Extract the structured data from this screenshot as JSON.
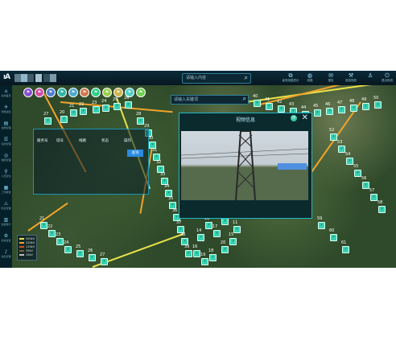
{
  "top_search": {
    "placeholder": "请输入内容"
  },
  "map_search": {
    "placeholder": "请输入关键词"
  },
  "tools": [
    {
      "label": "高亮线路显示",
      "icon": "layers-icon"
    },
    {
      "label": "线路",
      "icon": "globe-icon"
    },
    {
      "label": "报告",
      "icon": "mail-icon"
    },
    {
      "label": "巡检规划",
      "icon": "wrench-icon"
    },
    {
      "label": "",
      "icon": "user-icon"
    },
    {
      "label": "退出系统",
      "icon": "power-icon"
    }
  ],
  "sidebar": [
    {
      "label": "系统首页"
    },
    {
      "label": "智能巡检"
    },
    {
      "label": "台账管理"
    },
    {
      "label": "任务管理"
    },
    {
      "label": "缺陷管理"
    },
    {
      "label": "人员定位"
    },
    {
      "label": "工作报告"
    },
    {
      "label": "隐患管理"
    },
    {
      "label": "巡检统计"
    },
    {
      "label": "系统设置"
    },
    {
      "label": "消息管理"
    }
  ],
  "video_panel": {
    "title": "视频信息"
  },
  "table": {
    "headers": [
      "服务号",
      "塔号",
      "线路",
      "状态",
      "操作"
    ],
    "row": [
      "",
      "",
      "",
      "",
      ""
    ],
    "button": "查询"
  },
  "legend": [
    {
      "label": "500kV",
      "color": "#e9e24a"
    },
    {
      "label": "220kV",
      "color": "#f2a32a"
    },
    {
      "label": "110kV",
      "color": "#d94a2a"
    },
    {
      "label": "35kV",
      "color": "#8b5a2b"
    },
    {
      "label": "10kV",
      "color": "#c0c0c0"
    }
  ],
  "tower_numbers": [
    "27",
    "20",
    "21",
    "22",
    "23",
    "24",
    "25",
    "26",
    "28",
    "29",
    "30",
    "31",
    "32",
    "33",
    "34",
    "35",
    "36",
    "37",
    "38",
    "39",
    "40",
    "41",
    "42",
    "43",
    "44",
    "45",
    "46",
    "47",
    "48",
    "49",
    "50",
    "52",
    "53",
    "54",
    "55",
    "56",
    "57",
    "58",
    "59",
    "60",
    "61",
    "20",
    "18",
    "19",
    "16",
    "17",
    "15",
    "14",
    "13",
    "12",
    "11",
    "27",
    "26",
    "25",
    "24",
    "23",
    "22",
    "21"
  ]
}
